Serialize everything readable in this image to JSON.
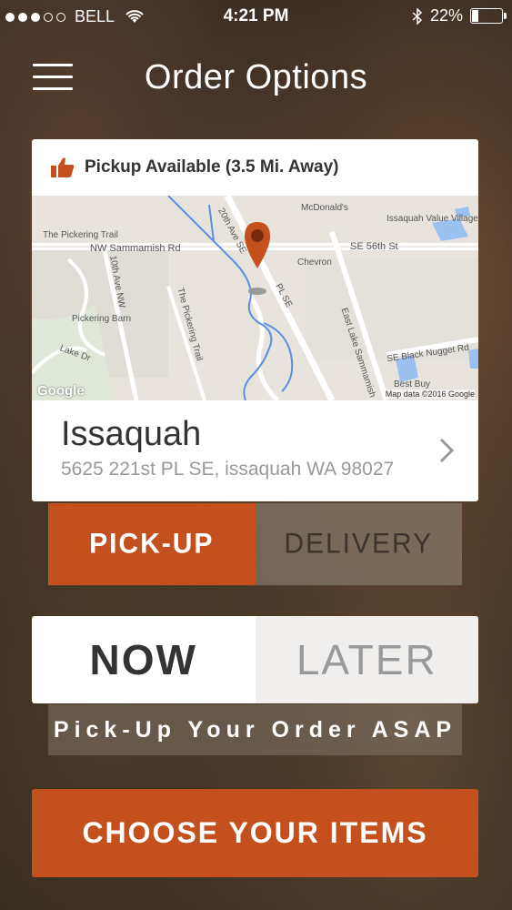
{
  "status_bar": {
    "carrier": "BELL",
    "time": "4:21 PM",
    "battery": "22%",
    "battery_level": 0.22
  },
  "header": {
    "title": "Order Options",
    "menu_icon": "hamburger-icon"
  },
  "location_card": {
    "availability": "Pickup Available (3.5 Mi. Away)",
    "availability_icon": "thumbs-up-icon",
    "map": {
      "labels": {
        "mcdonalds": "McDonald's",
        "value_village": "Issaquah Value Village",
        "pickering_trail": "The Pickering Trail",
        "sammamish_rd": "NW Sammamish Rd",
        "se_56th": "SE 56th St",
        "chevron": "Chevron",
        "tenth_ave": "10th Ave NW",
        "pickering_trail_v": "The Pickering Trail",
        "pickering_barn": "Pickering Barn",
        "lake_dr": "Lake Dr",
        "black_nugget": "SE Black Nugget Rd",
        "east_lake": "East Lake Sammamish",
        "best_buy": "Best Buy",
        "twentieth_ave": "20th Ave SE",
        "pl_se": "PL SE"
      },
      "google_logo": "Google",
      "credit": "Map data ©2016 Google"
    },
    "city": "Issaquah",
    "address": "5625 221st PL SE, issaquah WA 98027"
  },
  "fulfillment": {
    "pickup_label": "PICK-UP",
    "delivery_label": "DELIVERY",
    "selected": "PICK-UP"
  },
  "timing": {
    "now_label": "NOW",
    "later_label": "LATER",
    "selected": "NOW",
    "note": "Pick-Up Your Order ASAP"
  },
  "cta": {
    "label": "CHOOSE YOUR ITEMS"
  },
  "colors": {
    "accent": "#c4501d",
    "card_bg": "#ffffff"
  }
}
